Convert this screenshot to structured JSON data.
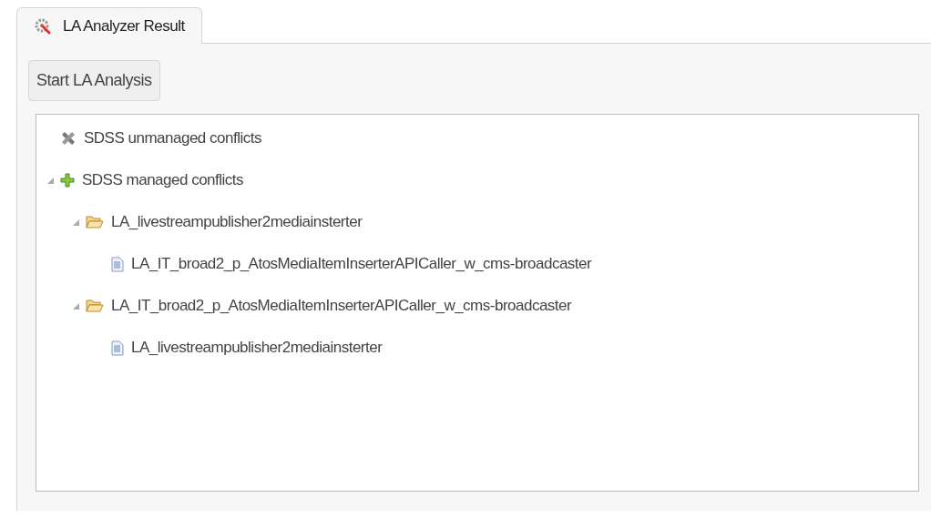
{
  "tabs": [
    {
      "label": "LA Analyzer Result",
      "selected": true
    }
  ],
  "button": "Start LA Analysis",
  "tree": [
    {
      "label": "SDSS unmanaged conflicts",
      "kind": "unmanaged"
    },
    {
      "label": "SDSS managed conflicts",
      "kind": "managed",
      "expanded": true,
      "children": [
        {
          "label": "LA_livestreampublisher2mediainsterter",
          "kind": "folder",
          "expanded": true,
          "children": [
            {
              "label": "LA_IT_broad2_p_AtosMediaItemInserterAPICaller_w_cms-broadcaster",
              "kind": "file"
            }
          ]
        },
        {
          "label": "LA_IT_broad2_p_AtosMediaItemInserterAPICaller_w_cms-broadcaster",
          "kind": "folder",
          "expanded": true,
          "children": [
            {
              "label": "LA_livestreampublisher2mediainsterter",
              "kind": "file"
            }
          ]
        }
      ]
    }
  ]
}
